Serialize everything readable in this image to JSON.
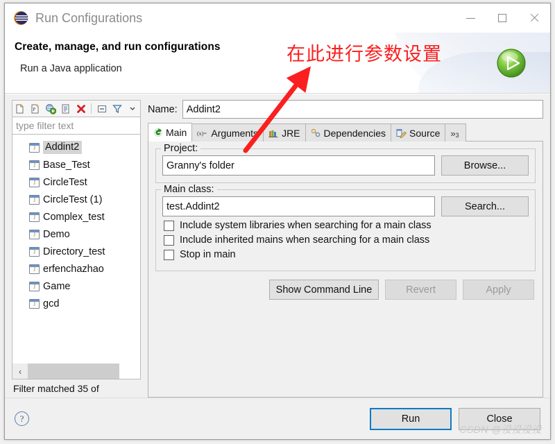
{
  "window": {
    "title": "Run Configurations",
    "logo_icon": "eclipse-logo-icon",
    "minimize_label": "",
    "maximize_label": "",
    "close_label": ""
  },
  "banner": {
    "title": "Create, manage, and run configurations",
    "subtitle": "Run a Java application",
    "badge_icon": "green-run-play-icon"
  },
  "annotation": {
    "text": "在此进行参数设置",
    "color": "#fb1f1f",
    "arrow_icon": "red-arrow-icon"
  },
  "left_panel": {
    "toolbar": [
      {
        "name": "new-configuration-icon",
        "glyph": "new"
      },
      {
        "name": "new-prototype-icon",
        "glyph": "prototype"
      },
      {
        "name": "duplicate-run-icon",
        "glyph": "runcopy"
      },
      {
        "name": "export-icon",
        "glyph": "export"
      },
      {
        "name": "delete-icon",
        "glyph": "delete"
      },
      {
        "name": "collapse-all-icon",
        "glyph": "collapse"
      },
      {
        "name": "filter-icon",
        "glyph": "filter"
      },
      {
        "name": "view-menu-chevron-icon",
        "glyph": "chevron"
      }
    ],
    "filter": {
      "placeholder": "type filter text",
      "value": ""
    },
    "tree_items": [
      {
        "label": "Addint2",
        "selected": true
      },
      {
        "label": "Base_Test",
        "selected": false
      },
      {
        "label": "CircleTest",
        "selected": false
      },
      {
        "label": "CircleTest (1)",
        "selected": false
      },
      {
        "label": "Complex_test",
        "selected": false
      },
      {
        "label": "Demo",
        "selected": false
      },
      {
        "label": "Directory_test",
        "selected": false
      },
      {
        "label": "erfenchazhao",
        "selected": false
      },
      {
        "label": "Game",
        "selected": false
      },
      {
        "label": "gcd",
        "selected": false
      }
    ],
    "scroll_left_glyph": "‹",
    "status": "Filter matched 35 of"
  },
  "right_panel": {
    "name_label": "Name:",
    "name_value": "Addint2",
    "tabs": [
      {
        "label": "Main",
        "icon": "main-tab-icon",
        "active": true
      },
      {
        "label": "Arguments",
        "icon": "arguments-tab-icon",
        "active": false
      },
      {
        "label": "JRE",
        "icon": "jre-tab-icon",
        "active": false
      },
      {
        "label": "Dependencies",
        "icon": "dependencies-tab-icon",
        "active": false
      },
      {
        "label": "Source",
        "icon": "source-tab-icon",
        "active": false
      }
    ],
    "tab_overflow": {
      "symbol": "»",
      "count": "3"
    },
    "project": {
      "group_label": "Project:",
      "value": "Granny's folder",
      "button": "Browse..."
    },
    "main_class": {
      "group_label": "Main class:",
      "value": "test.Addint2",
      "button": "Search..."
    },
    "checkboxes": [
      {
        "label": "Include system libraries when searching for a main class",
        "checked": false
      },
      {
        "label": "Include inherited mains when searching for a main class",
        "checked": false
      },
      {
        "label": "Stop in main",
        "checked": false
      }
    ],
    "actions": [
      {
        "label": "Show Command Line",
        "enabled": true
      },
      {
        "label": "Revert",
        "enabled": false
      },
      {
        "label": "Apply",
        "enabled": false
      }
    ]
  },
  "footer": {
    "help_icon": "help-question-icon",
    "help_glyph": "?",
    "run_label": "Run",
    "close_label": "Close",
    "watermark": "CSDN @没没没没"
  }
}
